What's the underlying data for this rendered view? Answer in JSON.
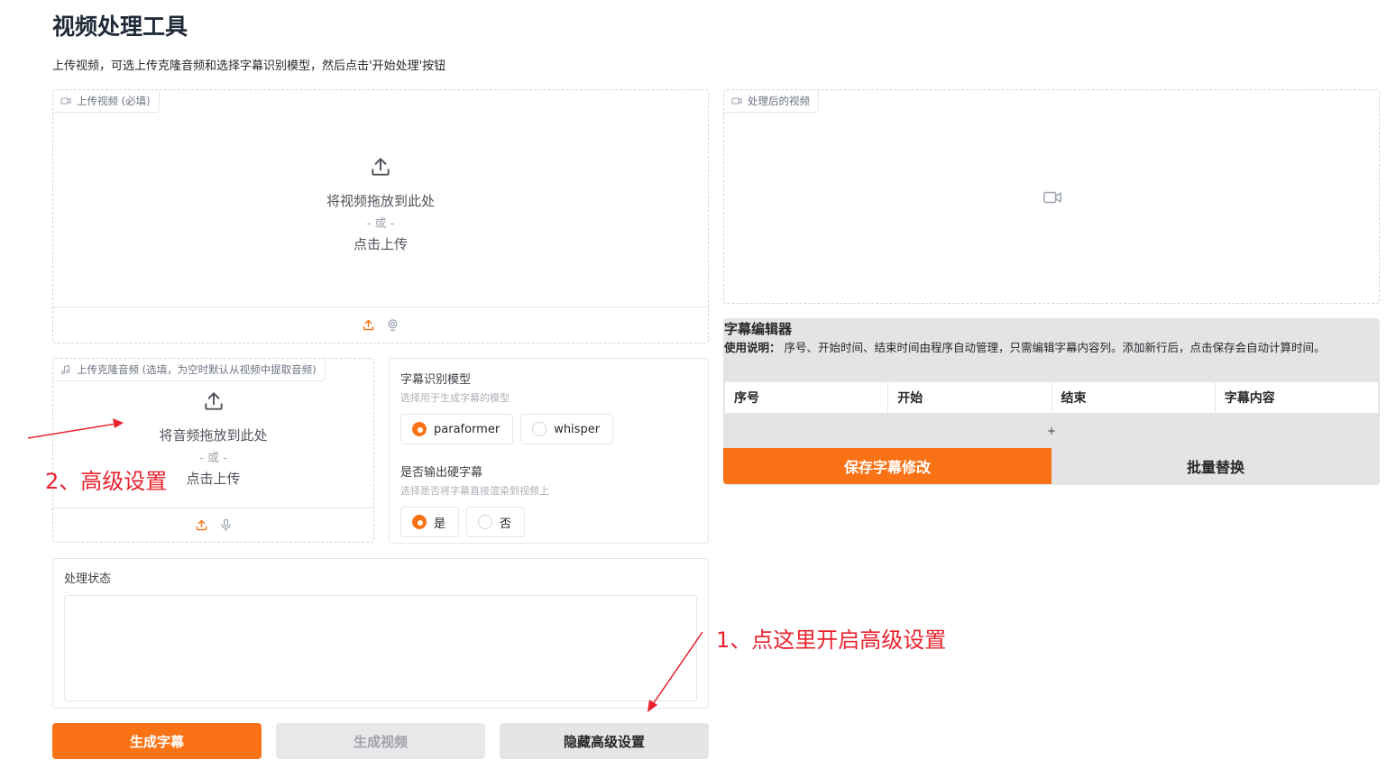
{
  "page": {
    "title": "视频处理工具",
    "description": "上传视频，可选上传克隆音频和选择字幕识别模型，然后点击'开始处理'按钮"
  },
  "video_upload": {
    "label": "上传视频 (必填)",
    "drop_text": "将视频拖放到此处",
    "or_text": "- 或 -",
    "click_text": "点击上传"
  },
  "audio_upload": {
    "label": "上传克隆音频 (选填，为空时默认从视频中提取音频)",
    "drop_text": "将音频拖放到此处",
    "or_text": "- 或 -",
    "click_text": "点击上传"
  },
  "subtitle_model": {
    "label": "字幕识别模型",
    "hint": "选择用于生成字幕的模型",
    "options": [
      "paraformer",
      "whisper"
    ],
    "selected": "paraformer"
  },
  "hard_subtitle": {
    "label": "是否输出硬字幕",
    "hint": "选择是否将字幕直接渲染到视频上",
    "options": [
      "是",
      "否"
    ],
    "selected": "是"
  },
  "status": {
    "label": "处理状态",
    "value": ""
  },
  "buttons": {
    "generate_subtitle": "生成字幕",
    "generate_video": "生成视频",
    "hide_advanced": "隐藏高级设置"
  },
  "output_video": {
    "label": "处理后的视频"
  },
  "subtitle_editor": {
    "title": "字幕编辑器",
    "note_label": "使用说明：",
    "note_text": " 序号、开始时间、结束时间由程序自动管理，只需编辑字幕内容列。添加新行后，点击保存会自动计算时间。",
    "columns": [
      "序号",
      "开始",
      "结束",
      "字幕内容"
    ],
    "add_row": "+",
    "save_button": "保存字幕修改",
    "batch_replace_button": "批量替换"
  },
  "annotations": {
    "step1": "1、点这里开启高级设置",
    "step2": "2、高级设置"
  },
  "colors": {
    "accent": "#f97316",
    "annotation": "#e8232f"
  }
}
